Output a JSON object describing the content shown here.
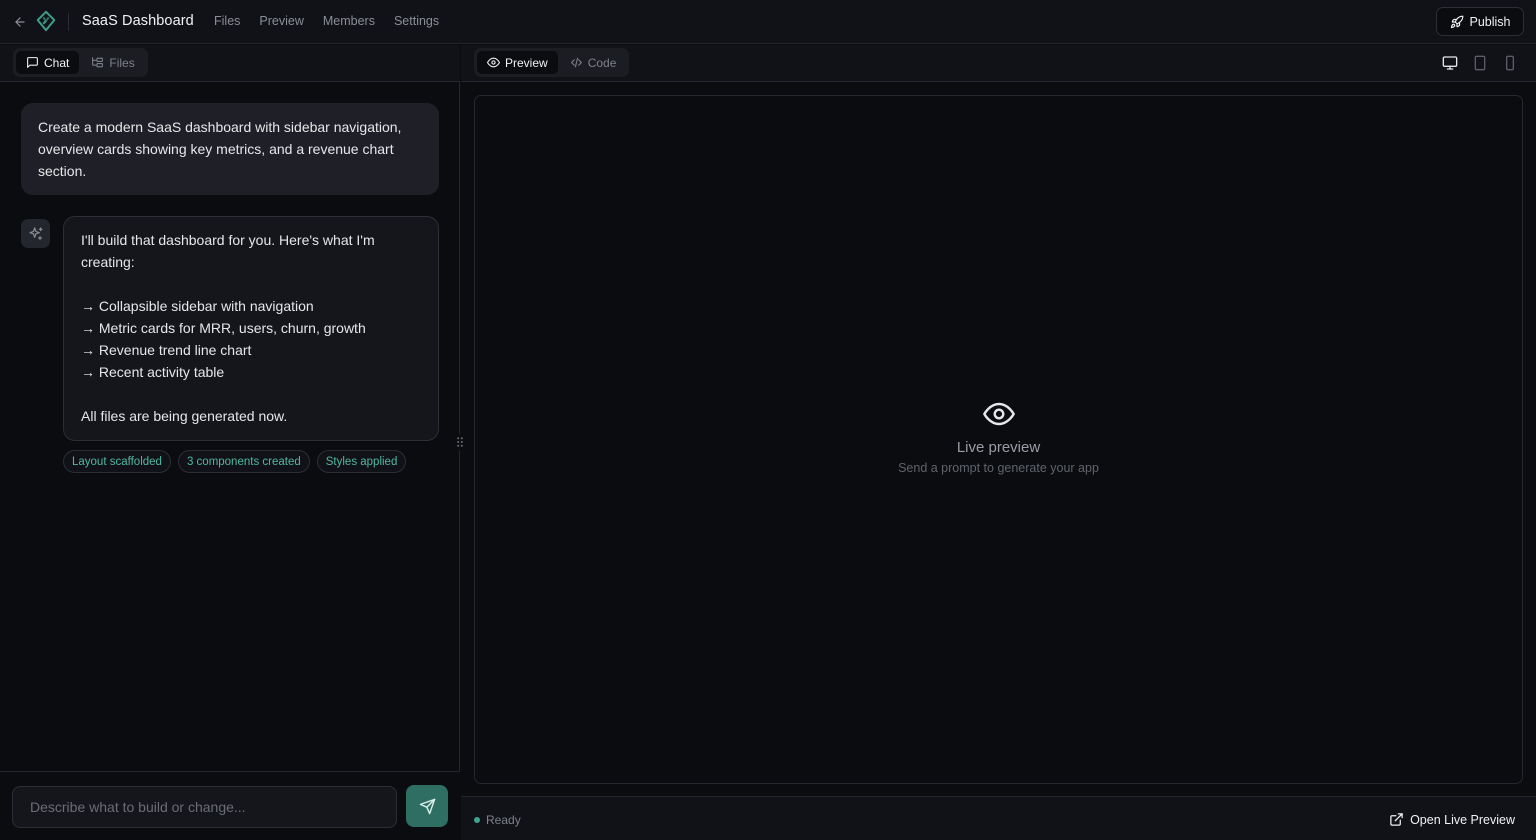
{
  "header": {
    "title": "SaaS Dashboard",
    "nav": [
      "Files",
      "Preview",
      "Members",
      "Settings"
    ],
    "publish_label": "Publish"
  },
  "left_panel": {
    "tabs": [
      {
        "label": "Chat",
        "icon": "chat-bubble-icon",
        "active": true
      },
      {
        "label": "Files",
        "icon": "file-tree-icon",
        "active": false
      }
    ],
    "user_message": "Create a modern SaaS dashboard with sidebar navigation, overview cards showing key metrics, and a revenue chart section.",
    "assistant_message": {
      "intro": "I'll build that dashboard for you. Here's what I'm creating:",
      "items": [
        "→ Collapsible sidebar with navigation",
        "→ Metric cards for MRR, users, churn, growth",
        "→ Revenue trend line chart",
        "→ Recent activity table"
      ],
      "outro": "All files are being generated now."
    },
    "status_chips": [
      "Layout scaffolded",
      "3 components created",
      "Styles applied"
    ],
    "composer": {
      "placeholder": "Describe what to build or change..."
    }
  },
  "right_panel": {
    "tabs": [
      {
        "label": "Preview",
        "icon": "eye-icon",
        "active": true
      },
      {
        "label": "Code",
        "icon": "code-icon",
        "active": false
      }
    ],
    "device_icons": [
      "desktop-icon",
      "tablet-icon",
      "mobile-icon"
    ],
    "preview_placeholder": {
      "title": "Live preview",
      "subtitle": "Send a prompt to generate your app"
    },
    "status": {
      "text": "Ready"
    },
    "open_live_label": "Open Live Preview"
  },
  "colors": {
    "background": "#0b0c10",
    "panel": "#111217",
    "accent": "#2f6e63",
    "chip_text": "#4fb8a2",
    "status_dot": "#3fa38d"
  }
}
